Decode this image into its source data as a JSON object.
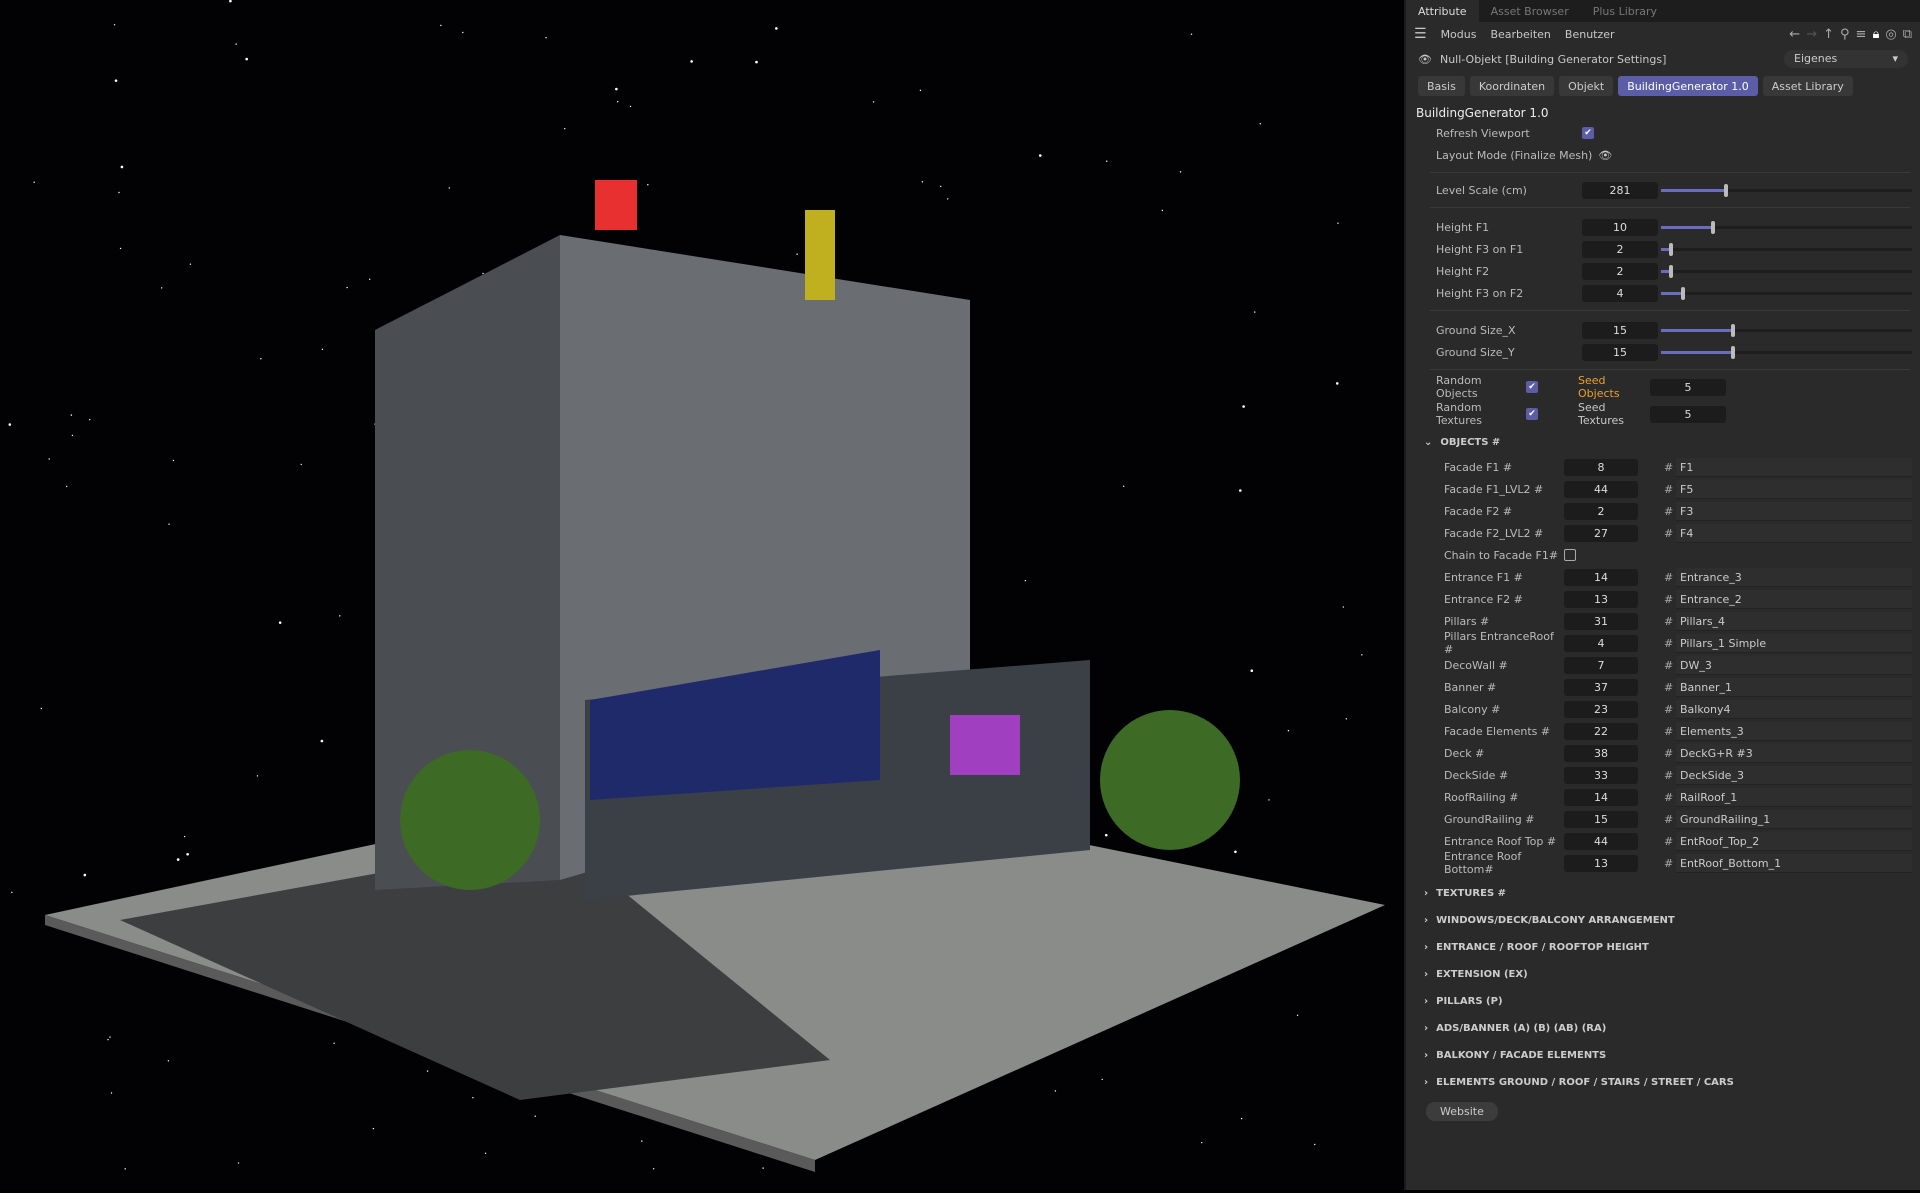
{
  "top_tabs": [
    "Attribute",
    "Asset Browser",
    "Plus Library"
  ],
  "menu": [
    "Modus",
    "Bearbeiten",
    "Benutzer"
  ],
  "object_title": "Null-Objekt [Building Generator Settings]",
  "dropdown": "Eigenes",
  "tabs": [
    "Basis",
    "Koordinaten",
    "Objekt",
    "BuildingGenerator 1.0",
    "Asset Library"
  ],
  "heading": "BuildingGenerator 1.0",
  "refresh_viewport": "Refresh Viewport",
  "layout_mode": "Layout Mode (Finalize Mesh)",
  "sliders": [
    {
      "label": "Level Scale (cm)",
      "value": "281",
      "fraction": 0.25
    },
    {
      "label": "Height F1",
      "value": "10",
      "fraction": 0.2
    },
    {
      "label": "Height F3 on F1",
      "value": "2",
      "fraction": 0.03
    },
    {
      "label": "Height F2",
      "value": "2",
      "fraction": 0.03
    },
    {
      "label": "Height F3 on F2",
      "value": "4",
      "fraction": 0.08
    },
    {
      "label": "Ground Size_X",
      "value": "15",
      "fraction": 0.28
    },
    {
      "label": "Ground Size_Y",
      "value": "15",
      "fraction": 0.28
    }
  ],
  "random_objects": "Random Objects",
  "seed_objects": "Seed Objects",
  "seed_objects_value": "5",
  "random_textures": "Random Textures",
  "seed_textures": "Seed Textures",
  "seed_textures_value": "5",
  "objects_header": "OBJECTS #",
  "objects": [
    {
      "label": "Facade F1 #",
      "value": "8",
      "name": "F1"
    },
    {
      "label": "Facade F1_LVL2 #",
      "value": "44",
      "name": "F5"
    },
    {
      "label": "Facade F2 #",
      "value": "2",
      "name": "F3"
    },
    {
      "label": "Facade F2_LVL2 #",
      "value": "27",
      "name": "F4"
    },
    {
      "label": "Entrance F1 #",
      "value": "14",
      "name": "Entrance_3"
    },
    {
      "label": "Entrance F2 #",
      "value": "13",
      "name": "Entrance_2"
    },
    {
      "label": "Pillars #",
      "value": "31",
      "name": "Pillars_4"
    },
    {
      "label": "Pillars EntranceRoof #",
      "value": "4",
      "name": "Pillars_1 Simple"
    },
    {
      "label": "DecoWall #",
      "value": "7",
      "name": "DW_3"
    },
    {
      "label": "Banner #",
      "value": "37",
      "name": "Banner_1"
    },
    {
      "label": "Balcony #",
      "value": "23",
      "name": "Balkony4"
    },
    {
      "label": "Facade Elements #",
      "value": "22",
      "name": "Elements_3"
    },
    {
      "label": "Deck #",
      "value": "38",
      "name": "DeckG+R #3"
    },
    {
      "label": "DeckSide #",
      "value": "33",
      "name": "DeckSide_3"
    },
    {
      "label": "RoofRailing #",
      "value": "14",
      "name": "RailRoof_1"
    },
    {
      "label": "GroundRailing #",
      "value": "15",
      "name": "GroundRailing_1"
    },
    {
      "label": "Entrance Roof Top #",
      "value": "44",
      "name": "EntRoof_Top_2"
    },
    {
      "label": "Entrance Roof Bottom#",
      "value": "13",
      "name": "EntRoof_Bottom_1"
    }
  ],
  "chain_label": "Chain to Facade F1#",
  "sections": [
    "TEXTURES #",
    "WINDOWS/DECK/BALCONY ARRANGEMENT",
    "ENTRANCE / ROOF / ROOFTOP HEIGHT",
    "EXTENSION (EX)",
    "PILLARS (P)",
    "ADS/BANNER (A) (B) (AB) (RA)",
    "BALKONY / FACADE ELEMENTS",
    "ELEMENTS GROUND / ROOF / STAIRS / STREET / CARS"
  ],
  "website": "Website",
  "colors": {
    "accent": "#5b5ea6",
    "seed_highlight": "#e8a030"
  }
}
